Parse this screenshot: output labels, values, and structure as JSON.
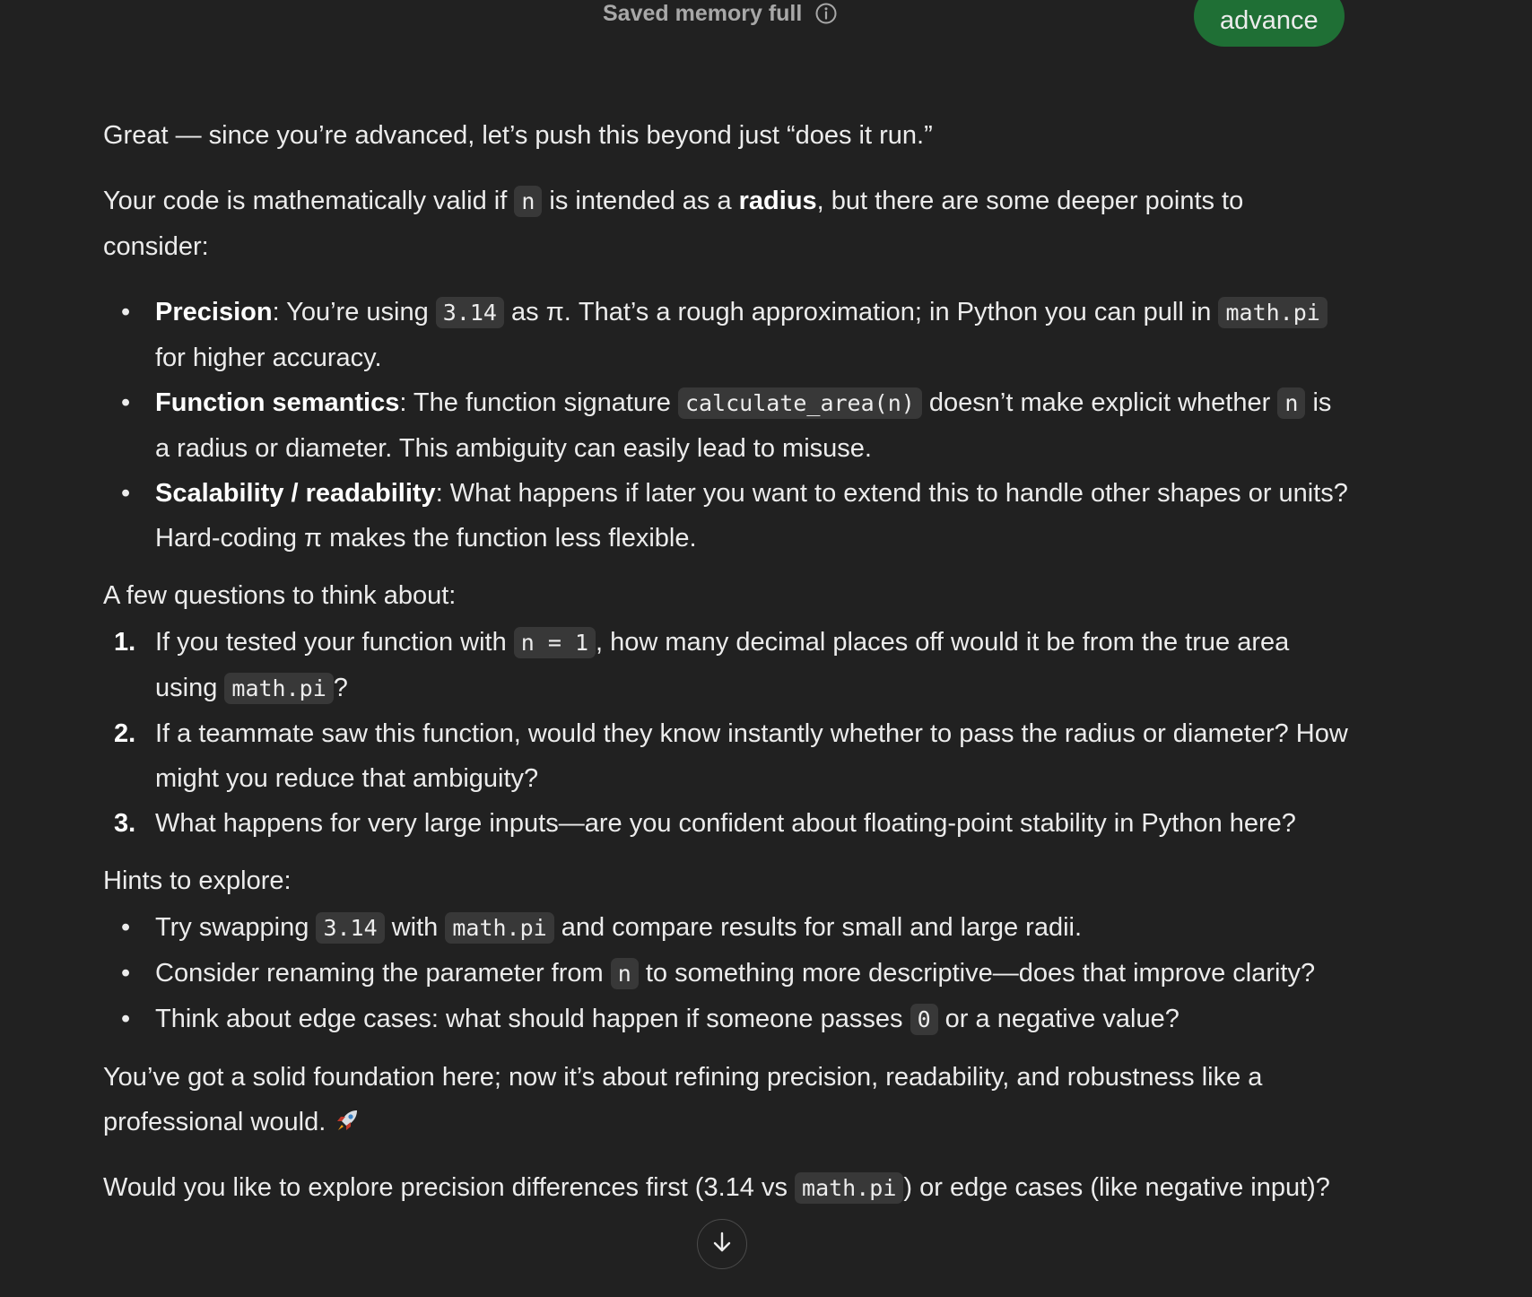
{
  "header": {
    "memory_status": "Saved memory full",
    "user_message": "advance"
  },
  "icons": {
    "info": "info-icon",
    "scroll_down": "arrow-down-icon",
    "emoji": "rocket-icon"
  },
  "colors": {
    "background": "#212121",
    "user_bubble": "#1f6f35",
    "code_background": "#383838"
  },
  "response": {
    "intro": "Great — since you’re advanced, let’s push this beyond just “does it run.”",
    "p2": {
      "t1": "Your code is mathematically valid if ",
      "c1": "n",
      "t2": " is intended as a ",
      "b1": "radius",
      "t3": ", but there are some deeper points to consider:"
    },
    "points": [
      {
        "title": "Precision",
        "t1": ": You’re using ",
        "c1": "3.14",
        "t2": " as π. That’s a rough approximation; in Python you can pull in ",
        "c2": "math.pi",
        "t3": " for higher accuracy."
      },
      {
        "title": "Function semantics",
        "t1": ": The function signature ",
        "c1": "calculate_area(n)",
        "t2": " doesn’t make explicit whether ",
        "c2": "n",
        "t3": " is a radius or diameter. This ambiguity can easily lead to misuse."
      },
      {
        "title": "Scalability / readability",
        "t1": ": What happens if later you want to extend this to handle other shapes or units? Hard-coding π makes the function less flexible."
      }
    ],
    "questions_heading": "A few questions to think about:",
    "questions": [
      {
        "num": "1.",
        "t1": "If you tested your function with ",
        "c1": "n = 1",
        "t2": ", how many decimal places off would it be from the true area using ",
        "c2": "math.pi",
        "t3": "?"
      },
      {
        "num": "2.",
        "t1": "If a teammate saw this function, would they know instantly whether to pass the radius or diameter? How might you reduce that ambiguity?"
      },
      {
        "num": "3.",
        "t1": "What happens for very large inputs—are you confident about floating-point stability in Python here?"
      }
    ],
    "hints_heading": "Hints to explore:",
    "hints": [
      {
        "t1": "Try swapping ",
        "c1": "3.14",
        "t2": " with ",
        "c2": "math.pi",
        "t3": " and compare results for small and large radii."
      },
      {
        "t1": "Consider renaming the parameter from ",
        "c1": "n",
        "t2": " to something more descriptive—does that improve clarity?"
      },
      {
        "t1": "Think about edge cases: what should happen if someone passes ",
        "c1": "0",
        "t2": " or a negative value?"
      }
    ],
    "closing": "You’ve got a solid foundation here; now it’s about refining precision, readability, and robustness like a professional would. ",
    "final": {
      "t1": "Would you like to explore precision differences first (3.14 vs ",
      "c1": "math.pi",
      "t2": ") or edge cases (like negative input)?"
    }
  }
}
